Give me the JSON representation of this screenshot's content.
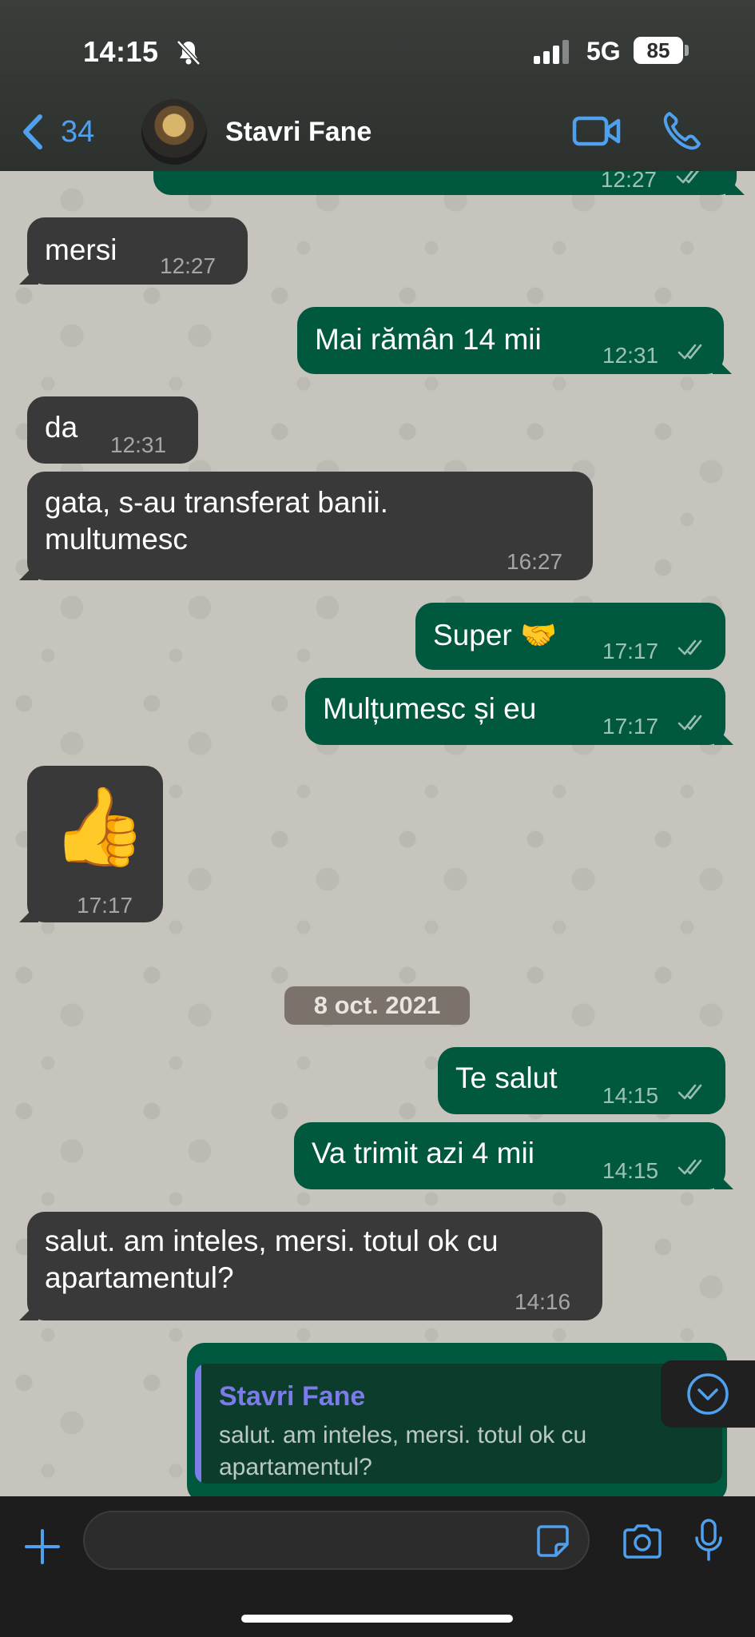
{
  "status_bar": {
    "time": "14:15",
    "network": "5G",
    "battery": "85"
  },
  "header": {
    "back_count": "34",
    "contact_name": "Stavri Fane",
    "avatar_label": "contact-avatar"
  },
  "colors": {
    "incoming_bubble": "#393939",
    "outgoing_bubble": "#00593e",
    "accent_blue": "#4fa0ee",
    "quote_accent": "#7b7be9"
  },
  "messages": [
    {
      "dir": "out",
      "text": "",
      "time": "12:27",
      "ticks": "read"
    },
    {
      "dir": "in",
      "text": "mersi",
      "time": "12:27"
    },
    {
      "dir": "out",
      "text": "Mai rămân 14 mii",
      "time": "12:31",
      "ticks": "read"
    },
    {
      "dir": "in",
      "text": "da",
      "time": "12:31"
    },
    {
      "dir": "in",
      "text_lines": [
        "gata, s-au transferat banii.",
        "multumesc"
      ],
      "time": "16:27"
    },
    {
      "dir": "out",
      "text": "Super 🤝",
      "time": "17:17",
      "ticks": "read"
    },
    {
      "dir": "out",
      "text": "Mulțumesc și eu",
      "time": "17:17",
      "ticks": "read"
    },
    {
      "dir": "in",
      "text": "👍",
      "time": "17:17"
    },
    {
      "dir": "out",
      "text": "Te salut",
      "time": "14:15",
      "ticks": "read"
    },
    {
      "dir": "out",
      "text": "Va trimit azi 4 mii",
      "time": "14:15",
      "ticks": "read"
    },
    {
      "dir": "in",
      "text_lines": [
        "salut. am inteles, mersi. totul ok cu",
        "apartamentul?"
      ],
      "time": "14:16"
    }
  ],
  "date_separator": "8 oct. 2021",
  "reply_quote": {
    "name": "Stavri Fane",
    "text": "salut. am inteles, mersi. totul ok cu apartamentul?"
  },
  "input": {
    "placeholder": "",
    "value": ""
  },
  "icons": [
    "mute-bell-icon",
    "signal-icon",
    "back-chevron-icon",
    "video-call-icon",
    "phone-call-icon",
    "read-ticks-icon",
    "scroll-down-icon",
    "plus-icon",
    "sticker-icon",
    "camera-icon",
    "microphone-icon"
  ]
}
